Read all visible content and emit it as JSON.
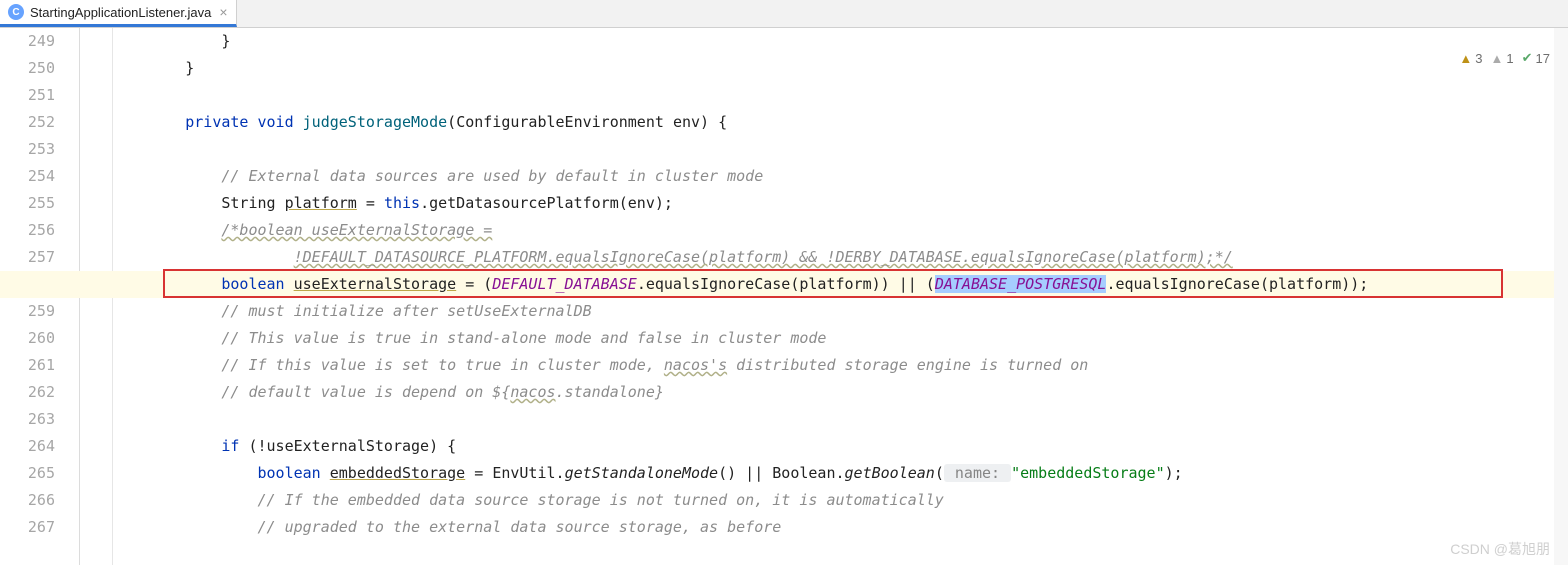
{
  "tab": {
    "filename": "StartingApplicationListener.java",
    "icon_letter": "C"
  },
  "inspections": {
    "warning_count": "3",
    "weak_count": "1",
    "ok_count": "17"
  },
  "gutter": {
    "start": 249,
    "end": 267
  },
  "code_lines": {
    "l249": {
      "indent": "            ",
      "brace": "}"
    },
    "l250": {
      "indent": "        ",
      "brace": "}"
    },
    "l251": {
      "text": ""
    },
    "l252": {
      "indent": "        ",
      "kw1": "private",
      "kw2": "void",
      "method": "judgeStorageMode",
      "paren_open": "(",
      "param_type": "ConfigurableEnvironment",
      "param_name": "env",
      "paren_close": ")",
      "brace": "{"
    },
    "l253": {
      "text": ""
    },
    "l254": {
      "indent": "            ",
      "comment": "// External data sources are used by default in cluster mode"
    },
    "l255": {
      "indent": "            ",
      "type": "String",
      "var": "platform",
      "eq": " = ",
      "kw_this": "this",
      "dot": ".",
      "call": "getDatasourcePlatform",
      "args_open": "(",
      "arg": "env",
      "args_close": ");"
    },
    "l256": {
      "indent": "            ",
      "comment": "/*boolean useExternalStorage ="
    },
    "l257": {
      "indent": "                    ",
      "comment": "!DEFAULT_DATASOURCE_PLATFORM.equalsIgnoreCase(platform) && !DERBY_DATABASE.equalsIgnoreCase(platform);*/"
    },
    "l258": {
      "indent": "            ",
      "kw": "boolean",
      "var": "useExternalStorage",
      "eq": " = (",
      "const1": "DEFAULT_DATABASE",
      "dot1": ".",
      "call1": "equalsIgnoreCase",
      "po1": "(",
      "arg1": "platform",
      "pc1": ")) || (",
      "const2": "DATABASE_POSTGRESQL",
      "dot2": ".",
      "call2": "equalsIgnoreCase",
      "po2": "(",
      "arg2": "platform",
      "pc2": "));"
    },
    "l259": {
      "indent": "            ",
      "comment": "// must initialize after setUseExternalDB"
    },
    "l260": {
      "indent": "            ",
      "comment": "// This value is true in stand-alone mode and false in cluster mode"
    },
    "l261": {
      "indent": "            ",
      "comment_a": "// If this value is set to true in cluster mode, ",
      "comment_u": "nacos's",
      "comment_b": " distributed storage engine is turned on"
    },
    "l262": {
      "indent": "            ",
      "comment_a": "// default value is depend on ${",
      "comment_u": "nacos",
      "comment_b": ".standalone}"
    },
    "l263": {
      "text": ""
    },
    "l264": {
      "indent": "            ",
      "kw_if": "if",
      "cond_open": " (!",
      "var": "useExternalStorage",
      "cond_close": ") {",
      "brace": ""
    },
    "l265": {
      "indent": "                ",
      "kw": "boolean",
      "var": "embeddedStorage",
      "eq": " = ",
      "cls1": "EnvUtil",
      "dot1": ".",
      "call1": "getStandaloneMode",
      "args1": "() || ",
      "cls2": "Boolean",
      "dot2": ".",
      "call2": "getBoolean",
      "po": "(",
      "hint": " name: ",
      "str": "\"embeddedStorage\"",
      "pc": ");"
    },
    "l266": {
      "indent": "                ",
      "comment": "// If the embedded data source storage is not turned on, it is automatically"
    },
    "l267": {
      "indent": "                ",
      "comment": "// upgraded to the external data source storage, as before"
    }
  },
  "watermark": "CSDN @葛旭朋"
}
